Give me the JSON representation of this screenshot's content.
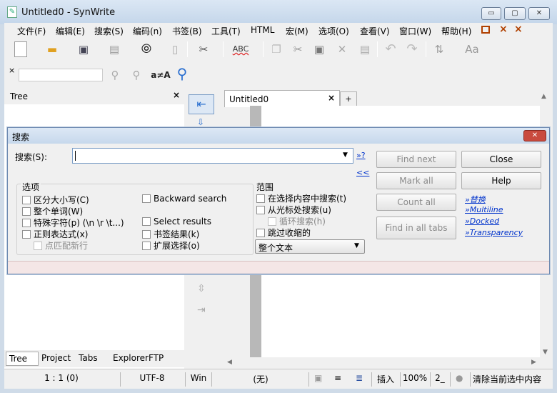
{
  "window": {
    "title": "Untitled0 - SynWrite",
    "min": "▭",
    "max": "▢",
    "close": "✕"
  },
  "menu": [
    "文件(F)",
    "编辑(E)",
    "搜索(S)",
    "编码(n)",
    "书签(B)",
    "工具(T)",
    "HTML",
    "宏(M)",
    "选项(O)",
    "查看(V)",
    "窗口(W)",
    "帮助(H)"
  ],
  "menu_extra": {
    "restore": "□",
    "close": "×",
    "close_all": "×"
  },
  "toolbar2": {
    "close_mark": "×",
    "match_case": "a≠A"
  },
  "tree_panel": {
    "title": "Tree",
    "close": "×"
  },
  "editor": {
    "tab": "Untitled0",
    "tab_close": "×",
    "add_tab": "+"
  },
  "bottom_tabs": [
    "Tree",
    "Project",
    "Tabs",
    "Explorer",
    "FTP"
  ],
  "status": {
    "position": "1 : 1 (0)",
    "encoding": "UTF-8",
    "lineend": "Win",
    "syntax": "(无)",
    "mode": "插入",
    "zoom": "100%",
    "num": "2_",
    "clear": "清除当前选中内容"
  },
  "dialog": {
    "title": "搜索",
    "close": "✕",
    "search_label": "搜索(S):",
    "search_value": "",
    "regex_help": "»?",
    "collapse": "<<",
    "options_title": "选项",
    "options": [
      {
        "label": "区分大小写(C)",
        "checked": false,
        "enabled": true
      },
      {
        "label": "整个单词(W)",
        "checked": false,
        "enabled": true
      },
      {
        "label": "特殊字符(p) (\\n \\r \\t...)",
        "checked": false,
        "enabled": true
      },
      {
        "label": "正则表达式(x)",
        "checked": false,
        "enabled": true
      },
      {
        "label": "点匹配新行",
        "checked": false,
        "enabled": false
      }
    ],
    "options2": [
      {
        "label": "Backward search",
        "checked": false
      },
      {
        "label": "Select results",
        "checked": false
      },
      {
        "label": "书签结果(k)",
        "checked": false
      },
      {
        "label": "扩展选择(o)",
        "checked": false
      }
    ],
    "scope_title": "范围",
    "scope": [
      {
        "label": "在选择内容中搜索(t)",
        "checked": false,
        "enabled": true
      },
      {
        "label": "从光标处搜索(u)",
        "checked": false,
        "enabled": true
      },
      {
        "label": "循环搜索(h)",
        "checked": false,
        "enabled": false
      },
      {
        "label": "跳过收缩的",
        "checked": false,
        "enabled": true
      }
    ],
    "scope_select": "整个文本",
    "buttons": {
      "find_next": "Find next",
      "mark_all": "Mark all",
      "count_all": "Count all",
      "find_in_tabs": "Find in all tabs",
      "close": "Close",
      "help": "Help"
    },
    "links": [
      "»替换",
      "»Multiline",
      "»Docked",
      "»Transparency"
    ]
  }
}
